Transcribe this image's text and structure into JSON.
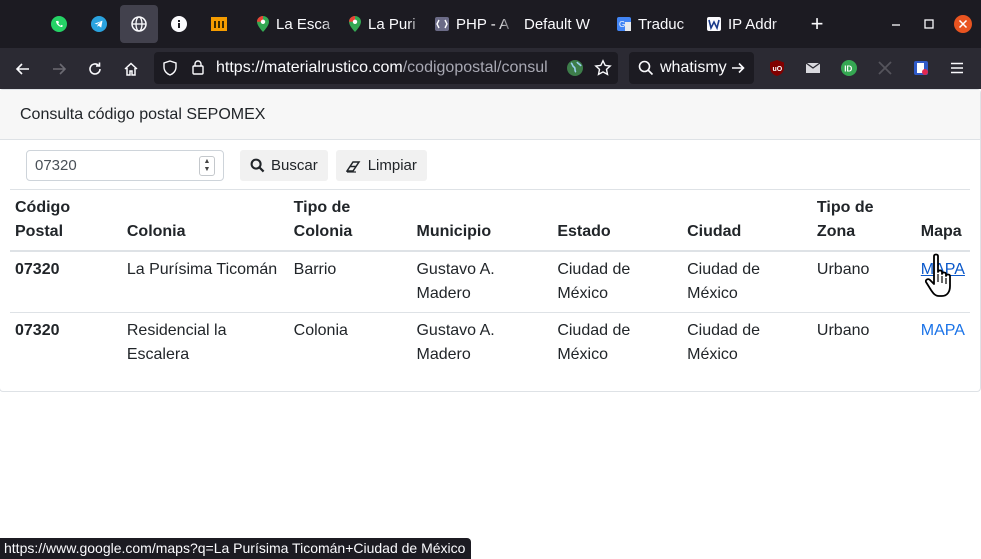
{
  "browser": {
    "tabs": [
      {
        "title": "La Esca",
        "icon": "maps-pin-icon"
      },
      {
        "title": "La Puri",
        "icon": "maps-pin-icon"
      },
      {
        "title": "PHP - A",
        "icon": "php-doc-icon"
      },
      {
        "title": "Default W",
        "icon": "blank-page-icon"
      },
      {
        "title": "Traduc",
        "icon": "google-translate-icon"
      },
      {
        "title": "IP Addr",
        "icon": "whatismyip-icon"
      }
    ],
    "new_tab_label": "+",
    "url_host": "https://materialrustico.com",
    "url_path": "/codigopostal/consul",
    "search_text": "whatismy",
    "status_url": "https://www.google.com/maps?q=La Purísima Ticomán+Ciudad de México"
  },
  "page": {
    "header_title": "Consulta código postal SEPOMEX",
    "search": {
      "value": "07320",
      "button_label": "Buscar",
      "clear_label": "Limpiar"
    },
    "table": {
      "headers": [
        {
          "line1": "Código",
          "line2": "Postal"
        },
        {
          "line1": "",
          "line2": "Colonia"
        },
        {
          "line1": "Tipo de",
          "line2": "Colonia"
        },
        {
          "line1": "",
          "line2": "Municipio"
        },
        {
          "line1": "",
          "line2": "Estado"
        },
        {
          "line1": "",
          "line2": "Ciudad"
        },
        {
          "line1": "Tipo de",
          "line2": "Zona"
        },
        {
          "line1": "",
          "line2": "Mapa"
        }
      ],
      "rows": [
        {
          "cp": "07320",
          "colonia": "La Purísima Ticomán",
          "tipo_colonia": "Barrio",
          "municipio": "Gustavo A. Madero",
          "estado": "Ciudad de México",
          "ciudad": "Ciudad de México",
          "zona": "Urbano",
          "mapa": "MAPA"
        },
        {
          "cp": "07320",
          "colonia": "Residencial la Escalera",
          "tipo_colonia": "Colonia",
          "municipio": "Gustavo A. Madero",
          "estado": "Ciudad de México",
          "ciudad": "Ciudad de México",
          "zona": "Urbano",
          "mapa": "MAPA"
        }
      ]
    }
  },
  "colors": {
    "link": "#1a73e8",
    "tabbar_bg": "#1c1b22",
    "navbar_bg": "#2b2a33"
  }
}
